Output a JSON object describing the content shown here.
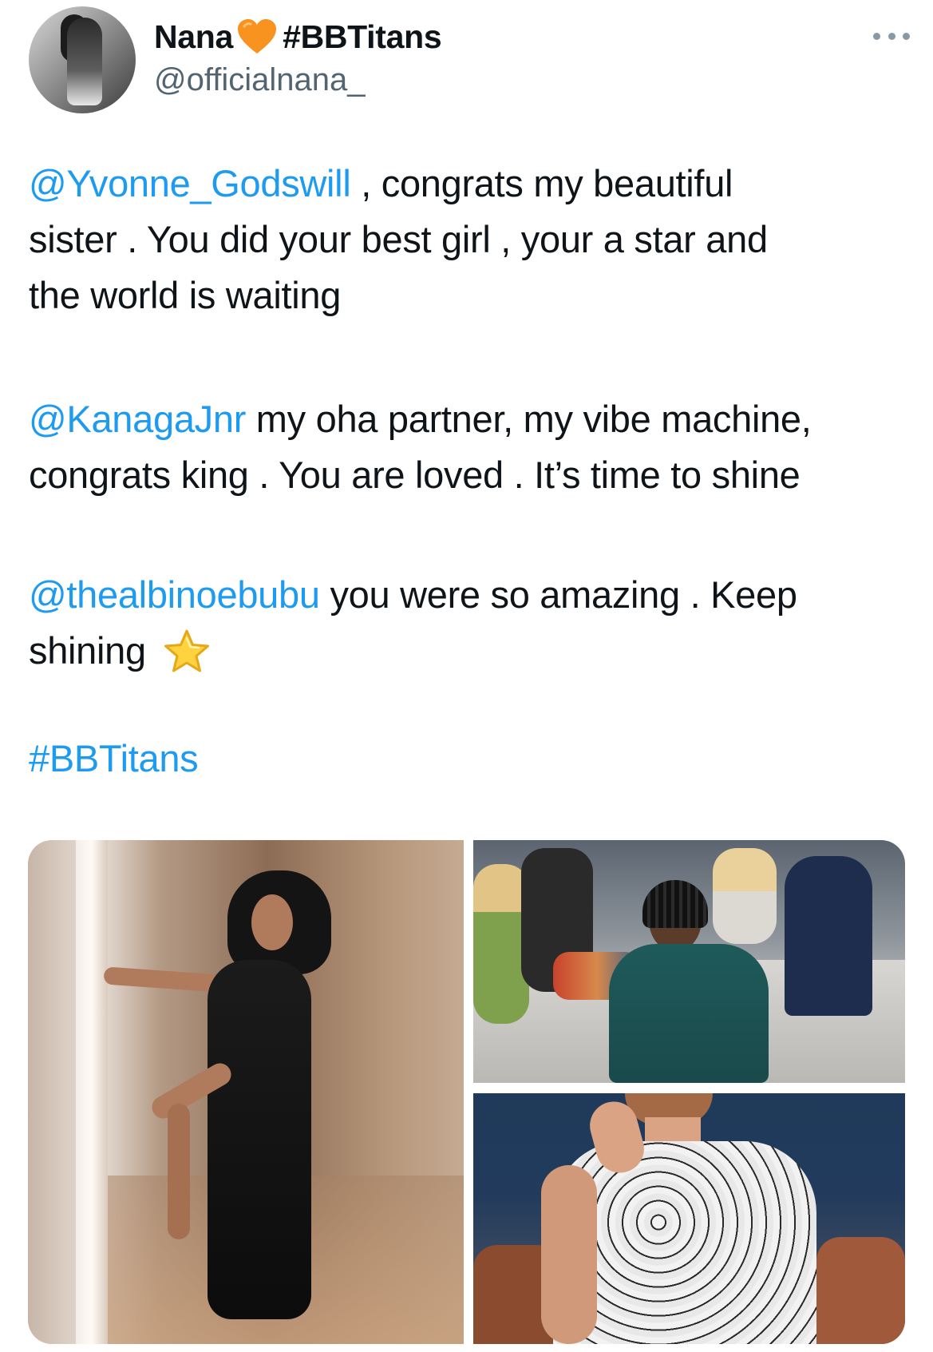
{
  "tweet": {
    "display_name": "Nana",
    "name_hashtag": "#BBTitans",
    "handle": "@officialnana_",
    "paragraphs": [
      {
        "lines": [
          {
            "mention": "@Yvonne_Godswill",
            "text": " , congrats my beautiful"
          },
          {
            "text": "sister . You did your best girl , your a star and"
          },
          {
            "text": "the world is waiting"
          }
        ]
      },
      {
        "lines": [
          {
            "mention": "@KanagaJnr",
            "text": " my oha partner, my vibe machine,"
          },
          {
            "text": "congrats king . You are loved . It’s time to shine"
          }
        ]
      },
      {
        "lines": [
          {
            "mention": "@thealbinoebubu",
            "text": "  you were so amazing . Keep"
          },
          {
            "text": "shining",
            "emoji": "star-icon"
          }
        ]
      },
      {
        "lines": [
          {
            "mention": "#BBTitans"
          }
        ]
      }
    ],
    "media": [
      {
        "name": "photo-woman-black-dress"
      },
      {
        "name": "photo-man-green-outfit"
      },
      {
        "name": "photo-man-paisley-shirt"
      }
    ]
  },
  "colors": {
    "link": "#1d9bf0",
    "text": "#0f1419",
    "secondary": "#536471",
    "heart": "#f7931e"
  },
  "icons": {
    "verified_heart": "orange-heart-icon",
    "more": "more-horizontal-icon",
    "star": "star-icon"
  }
}
